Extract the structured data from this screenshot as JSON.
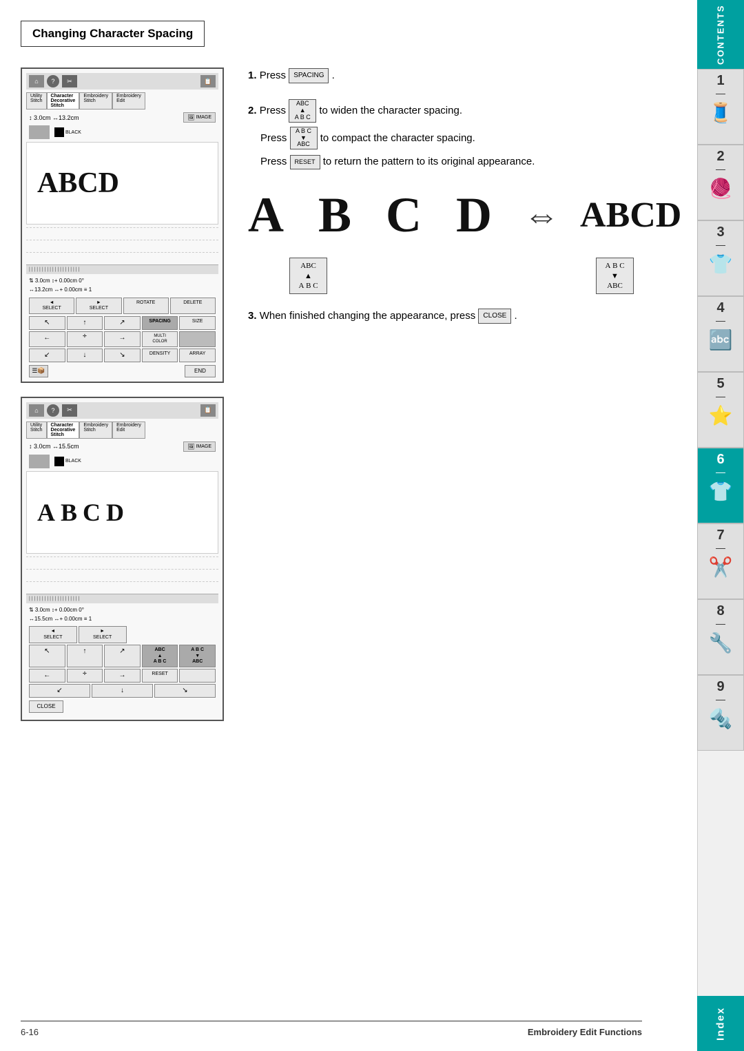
{
  "heading": "Changing Character Spacing",
  "steps": {
    "step1": {
      "num": "1.",
      "text": "Press",
      "btn": "SPACING"
    },
    "step2": {
      "num": "2.",
      "line1_pre": "Press",
      "line1_post": "to widen the character spacing.",
      "line2_pre": "Press",
      "line2_post": "to compact the character spacing.",
      "line3_pre": "Press",
      "line3_btn": "RESET",
      "line3_post": "to return the pattern to its original appearance."
    },
    "step3": {
      "num": "3.",
      "pre": "When finished changing the appearance, press",
      "btn": "CLOSE"
    }
  },
  "diagram": {
    "text_wide": "A  B  C  D",
    "arrow": "⇔",
    "text_compact": "ABCD"
  },
  "abc_btn_wide": "ABC\n▲\nA B C",
  "abc_btn_compact": "A B C\n▼\nABC",
  "footer": {
    "left": "6-16",
    "right": "Embroidery Edit Functions"
  },
  "sidebar": {
    "contents_label": "CONTENTS",
    "tabs": [
      {
        "num": "1",
        "icon": "🧵"
      },
      {
        "num": "2",
        "icon": "🧶"
      },
      {
        "num": "3",
        "icon": "👕"
      },
      {
        "num": "4",
        "icon": "🔤"
      },
      {
        "num": "5",
        "icon": "⭐"
      },
      {
        "num": "6",
        "icon": "👕",
        "active": true
      },
      {
        "num": "7",
        "icon": "✂️"
      },
      {
        "num": "8",
        "icon": "🔧"
      },
      {
        "num": "9",
        "icon": "🔩"
      }
    ],
    "index_label": "Index"
  },
  "screen1": {
    "menu_tabs": [
      "Utility Stitch",
      "Character Decorative Stitch",
      "Embroidery Stitch",
      "Embroidery Edit"
    ],
    "info": "↕ 3.0cm ↔13.2cm",
    "color": "BLACK",
    "preview_text": "ABCD",
    "params1": "⇅ 3.0cm  ↕+ 0.00cm  0°",
    "params2": "↔13.2cm ↔+ 0.00cm ≡ 1",
    "btns_row1": [
      "◄ SELECT",
      "► SELECT",
      "ROTATE",
      "DELETE"
    ],
    "btns_row2": [
      "↖",
      "↑",
      "↗",
      "SPACING",
      "SIZE"
    ],
    "btns_row3": [
      "←",
      "✛",
      "→",
      "MULTI COLOR",
      ""
    ],
    "btns_row4": [
      "↙",
      "↓",
      "↘",
      "DENSITY",
      "ARRAY"
    ],
    "btn_end": "END"
  },
  "screen2": {
    "info": "↕ 3.0cm ↔15.5cm",
    "color": "BLACK",
    "preview_text": "ABCD",
    "params1": "⇅ 3.0cm  ↕+ 0.00cm  0°",
    "params2": "↔15.5cm ↔+ 0.00cm ≡ 1",
    "btn_close": "CLOSE",
    "btn_reset": "RESET"
  }
}
